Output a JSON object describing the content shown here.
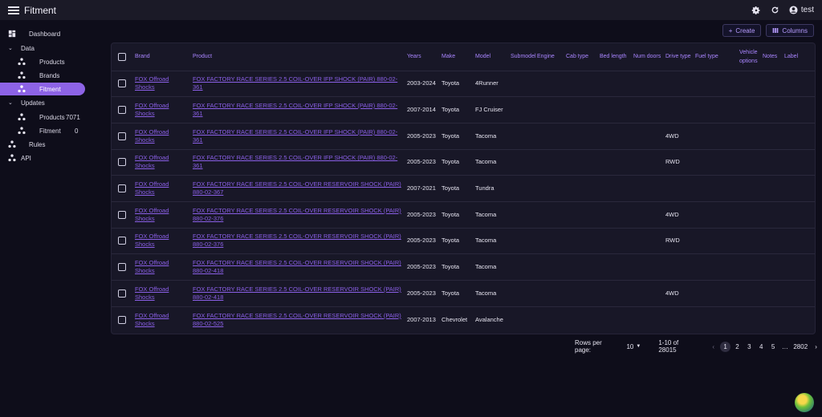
{
  "app": {
    "title": "Fitment",
    "user": "test"
  },
  "sidebar": {
    "dashboard": "Dashboard",
    "data": "Data",
    "products": "Products",
    "brands": "Brands",
    "fitment": "Fitment",
    "updates": "Updates",
    "updates_products": "Products",
    "updates_products_count": "7071",
    "updates_fitment": "Fitment",
    "updates_fitment_count": "0",
    "rules": "Rules",
    "api": "API"
  },
  "toolbar": {
    "create": "Create",
    "columns": "Columns"
  },
  "columns": [
    "Brand",
    "Product",
    "Years",
    "Make",
    "Model",
    "Submodel",
    "Engine",
    "Cab type",
    "Bed length",
    "Num doors",
    "Drive type",
    "Fuel type",
    "Vehicle options",
    "Notes",
    "Label"
  ],
  "rows": [
    {
      "brand": "FOX Offroad Shocks",
      "product": "FOX FACTORY RACE SERIES 2.5 COIL-OVER IFP SHOCK (PAIR) 880-02-361",
      "years": "2003-2024",
      "make": "Toyota",
      "model": "4Runner",
      "drive": ""
    },
    {
      "brand": "FOX Offroad Shocks",
      "product": "FOX FACTORY RACE SERIES 2.5 COIL-OVER IFP SHOCK (PAIR) 880-02-361",
      "years": "2007-2014",
      "make": "Toyota",
      "model": "FJ Cruiser",
      "drive": ""
    },
    {
      "brand": "FOX Offroad Shocks",
      "product": "FOX FACTORY RACE SERIES 2.5 COIL-OVER IFP SHOCK (PAIR) 880-02-361",
      "years": "2005-2023",
      "make": "Toyota",
      "model": "Tacoma",
      "drive": "4WD"
    },
    {
      "brand": "FOX Offroad Shocks",
      "product": "FOX FACTORY RACE SERIES 2.5 COIL-OVER IFP SHOCK (PAIR) 880-02-361",
      "years": "2005-2023",
      "make": "Toyota",
      "model": "Tacoma",
      "drive": "RWD"
    },
    {
      "brand": "FOX Offroad Shocks",
      "product": "FOX FACTORY RACE SERIES 2.5 COIL-OVER RESERVOIR SHOCK (PAIR) 880-02-367",
      "years": "2007-2021",
      "make": "Toyota",
      "model": "Tundra",
      "drive": ""
    },
    {
      "brand": "FOX Offroad Shocks",
      "product": "FOX FACTORY RACE SERIES 2.5 COIL-OVER RESERVOIR SHOCK (PAIR) 880-02-376",
      "years": "2005-2023",
      "make": "Toyota",
      "model": "Tacoma",
      "drive": "4WD"
    },
    {
      "brand": "FOX Offroad Shocks",
      "product": "FOX FACTORY RACE SERIES 2.5 COIL-OVER RESERVOIR SHOCK (PAIR) 880-02-376",
      "years": "2005-2023",
      "make": "Toyota",
      "model": "Tacoma",
      "drive": "RWD"
    },
    {
      "brand": "FOX Offroad Shocks",
      "product": "FOX FACTORY RACE SERIES 2.5 COIL-OVER RESERVOIR SHOCK (PAIR) 880-02-418",
      "years": "2005-2023",
      "make": "Toyota",
      "model": "Tacoma",
      "drive": ""
    },
    {
      "brand": "FOX Offroad Shocks",
      "product": "FOX FACTORY RACE SERIES 2.5 COIL-OVER RESERVOIR SHOCK (PAIR) 880-02-418",
      "years": "2005-2023",
      "make": "Toyota",
      "model": "Tacoma",
      "drive": "4WD"
    },
    {
      "brand": "FOX Offroad Shocks",
      "product": "FOX FACTORY RACE SERIES 2.5 COIL-OVER RESERVOIR SHOCK (PAIR) 880-02-525",
      "years": "2007-2013",
      "make": "Chevrolet",
      "model": "Avalanche",
      "drive": ""
    }
  ],
  "pagination": {
    "rows_per_page_label": "Rows per page:",
    "rows_per_page": "10",
    "range": "1-10 of 28015",
    "pages": [
      "1",
      "2",
      "3",
      "4",
      "5"
    ],
    "ellipsis": "…",
    "last_page": "2802",
    "current_page": "1"
  },
  "colors": {
    "accent": "#8d63e6",
    "link": "#8a5fe6",
    "background": "#0e0d1a",
    "topbar": "#1b1a27"
  }
}
